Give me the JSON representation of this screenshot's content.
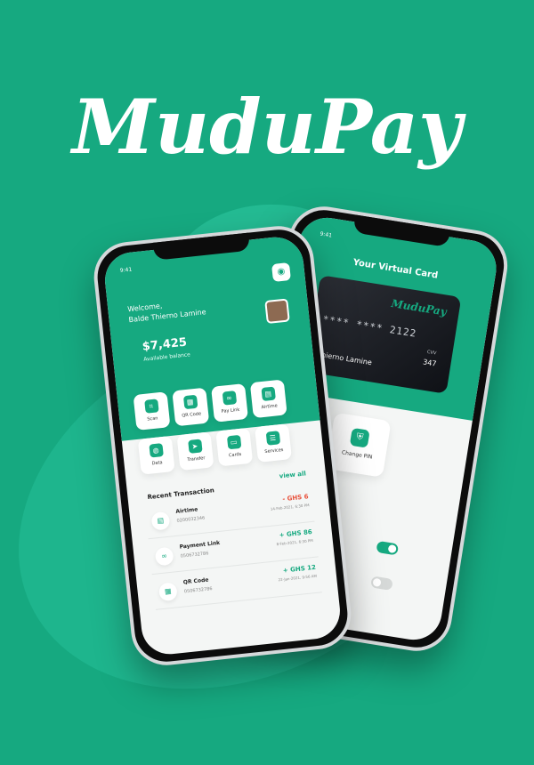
{
  "brand": {
    "name": "MuduPay",
    "color": "#16a980"
  },
  "status_time": "9:41",
  "virtual_card": {
    "title": "Your Virtual Card",
    "card_logo": "MuduPay",
    "number": "**** **** 2122",
    "cvv_label": "CVV",
    "cvv": "347",
    "holder": "Thierno Lamine",
    "action_label": "Change PIN"
  },
  "home": {
    "welcome": "Welcome,",
    "user": "Balde Thierno Lamine",
    "balance": "$7,425",
    "balance_label": "Available balance",
    "actions": [
      {
        "label": "Scan",
        "icon": "scan-icon"
      },
      {
        "label": "QR Code",
        "icon": "qr-icon"
      },
      {
        "label": "Pay Link",
        "icon": "link-icon"
      },
      {
        "label": "Airtime",
        "icon": "sim-icon"
      },
      {
        "label": "Data",
        "icon": "globe-icon"
      },
      {
        "label": "Transfer",
        "icon": "send-icon"
      },
      {
        "label": "Cards",
        "icon": "card-icon"
      },
      {
        "label": "Services",
        "icon": "services-icon"
      }
    ],
    "recent_title": "Recent Transaction",
    "view_all": "view all",
    "transactions": [
      {
        "name": "Airtime",
        "phone": "0200032346",
        "amount": "- GHS 6",
        "date": "14-Feb-2021, 6:30 PM",
        "color": "#e8503a"
      },
      {
        "name": "Payment Link",
        "phone": "0506732786",
        "amount": "+ GHS 86",
        "date": "8-Feb-2021, 6:30 PM",
        "color": "#16a980"
      },
      {
        "name": "QR Code",
        "phone": "0506732786",
        "amount": "+ GHS 12",
        "date": "22-Jan-2021, 9:56 AM",
        "color": "#16a980"
      }
    ]
  }
}
